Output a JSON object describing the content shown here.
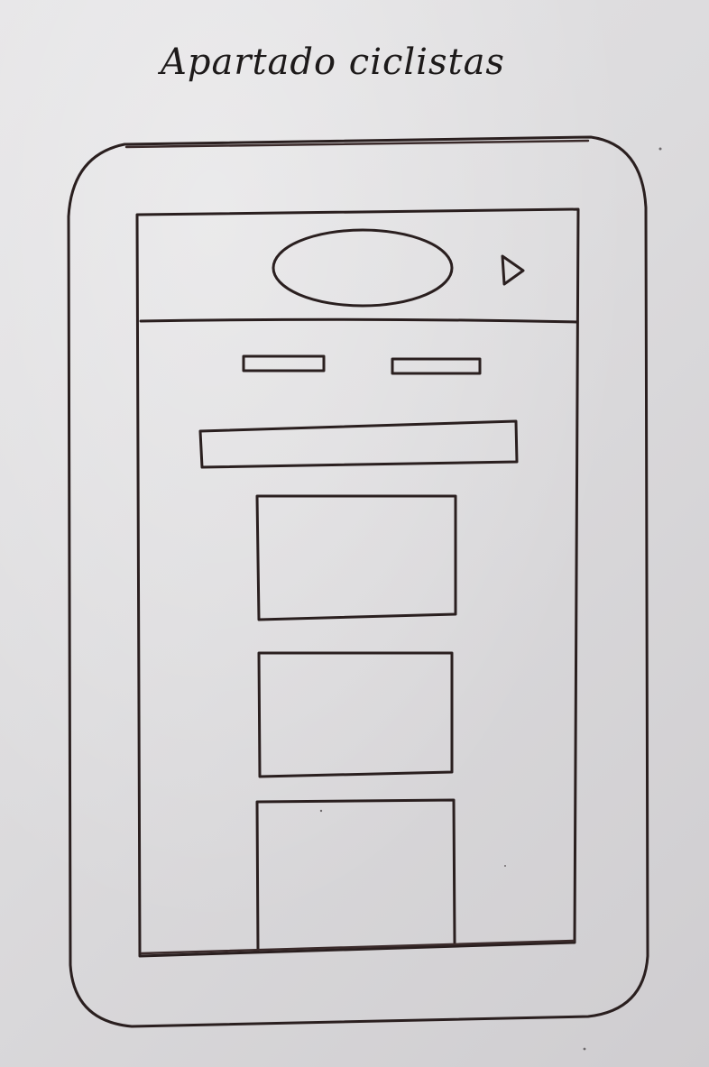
{
  "sketch": {
    "title": "Apartado ciclistas"
  },
  "colors": {
    "paper": "#dcdbdd",
    "ink": "#2a1f1f"
  },
  "icons": {
    "header_logo": "oval-logo-placeholder",
    "header_action": "play-triangle-icon"
  }
}
